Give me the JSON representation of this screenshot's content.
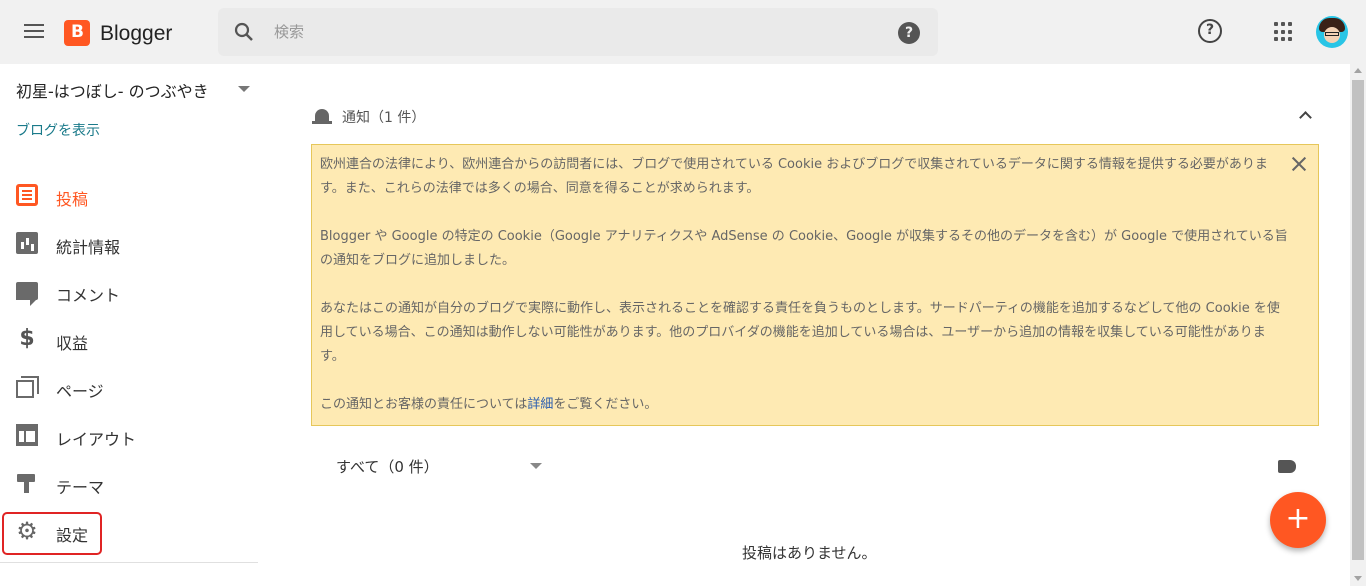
{
  "header": {
    "brand": "Blogger",
    "search_placeholder": "検索",
    "search_help_glyph": "?",
    "help_glyph": "?"
  },
  "sidebar": {
    "blog_name": "初星-はつぼし- のつぶやき",
    "view_blog": "ブログを表示",
    "items": [
      {
        "label": "投稿",
        "icon": "posts-icon",
        "active": true
      },
      {
        "label": "統計情報",
        "icon": "stats-icon"
      },
      {
        "label": "コメント",
        "icon": "comment-icon"
      },
      {
        "label": "収益",
        "icon": "dollar-icon"
      },
      {
        "label": "ページ",
        "icon": "pages-icon"
      },
      {
        "label": "レイアウト",
        "icon": "layout-icon"
      },
      {
        "label": "テーマ",
        "icon": "theme-icon"
      },
      {
        "label": "設定",
        "icon": "gear-icon",
        "highlighted": true
      }
    ],
    "dollar_glyph": "$",
    "gear_glyph": "⚙"
  },
  "notification": {
    "title": "通知（1 件）",
    "paragraphs": [
      "欧州連合の法律により、欧州連合からの訪問者には、ブログで使用されている Cookie およびブログで収集されているデータに関する情報を提供する必要があります。また、これらの法律では多くの場合、同意を得ることが求められます。",
      "Blogger や Google の特定の Cookie（Google アナリティクスや AdSense の Cookie、Google が収集するその他のデータを含む）が Google で使用されている旨の通知をブログに追加しました。",
      "あなたはこの通知が自分のブログで実際に動作し、表示されることを確認する責任を負うものとします。サードパーティの機能を追加するなどして他の Cookie を使用している場合、この通知は動作しない可能性があります。他のプロバイダの機能を追加している場合は、ユーザーから追加の情報を収集している可能性があります。"
    ],
    "last_prefix": "この通知とお客様の責任については",
    "last_link": "詳細",
    "last_suffix": "をご覧ください。"
  },
  "posts": {
    "filter": "すべて（0 件）",
    "fab_glyph": "+",
    "empty_message": "投稿はありません。"
  },
  "colors": {
    "accent": "#ff5722",
    "notice_bg": "#feeab3",
    "link": "#2a5db0",
    "highlight_border": "#e02424"
  }
}
